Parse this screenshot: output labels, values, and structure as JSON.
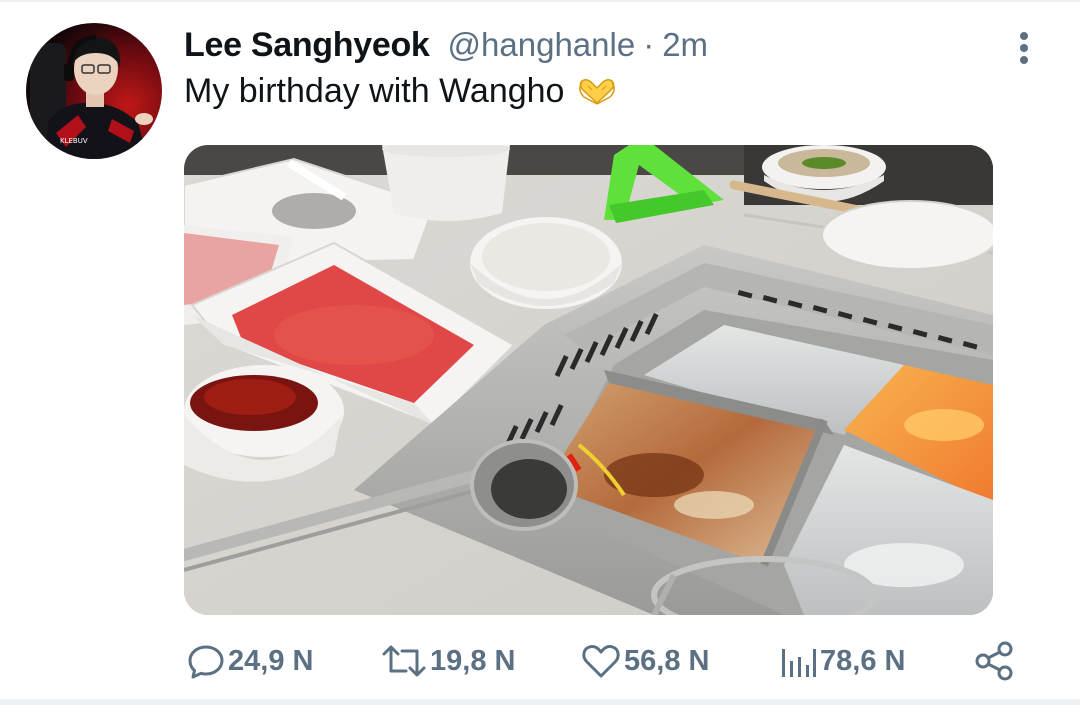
{
  "tweet": {
    "author_name": "Lee Sanghyeok",
    "author_handle": "@hanghanle",
    "separator": "·",
    "timestamp": "2m",
    "text": "My birthday with Wangho",
    "emoji": "heart-hands-emoji",
    "avatar_icon": "avatar",
    "more_icon": "vertical-ellipsis-icon"
  },
  "media": {
    "description_icon": "hotpot-photo"
  },
  "actions": {
    "replies": "24,9 N",
    "retweets": "19,8 N",
    "likes": "56,8 N",
    "views": "78,6 N"
  },
  "colors": {
    "text_primary": "#0f1419",
    "text_secondary": "#5b7083",
    "icon": "#5b7083",
    "divider": "#eef1f3"
  }
}
